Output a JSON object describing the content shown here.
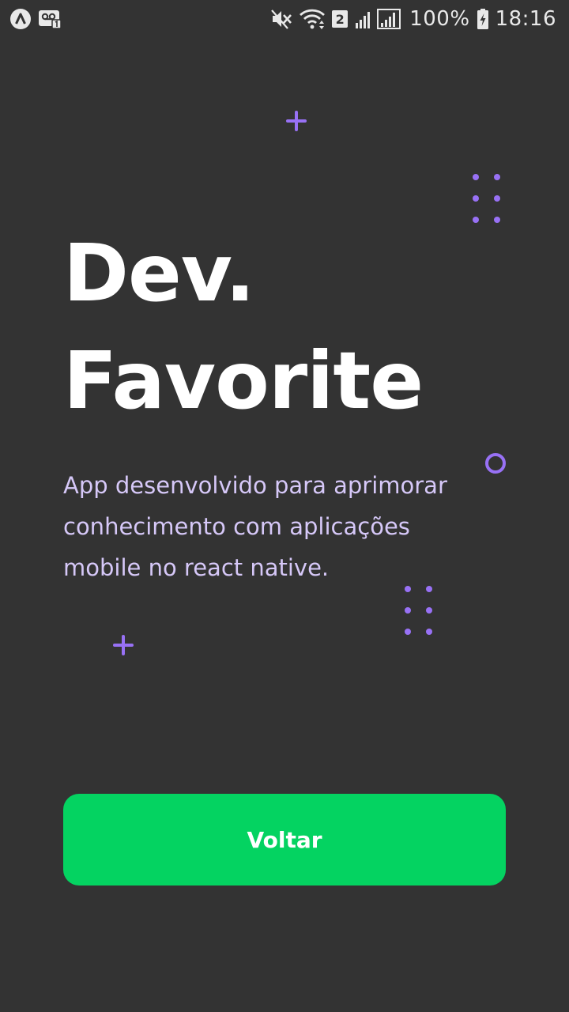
{
  "status_bar": {
    "battery": "100%",
    "time": "18:16",
    "sim_slot": "2",
    "icons": [
      "app-notification-icon",
      "voicemail-icon",
      "mute-icon",
      "wifi-icon",
      "signal-icon",
      "battery-charging-icon"
    ]
  },
  "hero": {
    "title_line1": "Dev.",
    "title_line2": "Favorite",
    "description": "App desenvolvido para aprimorar conhecimento com aplicações mobile no react native."
  },
  "actions": {
    "back_label": "Voltar"
  },
  "colors": {
    "background": "#333333",
    "accent_purple": "#9871f5",
    "description_text": "#d6c8f8",
    "button_green": "#04d361",
    "white": "#ffffff"
  }
}
